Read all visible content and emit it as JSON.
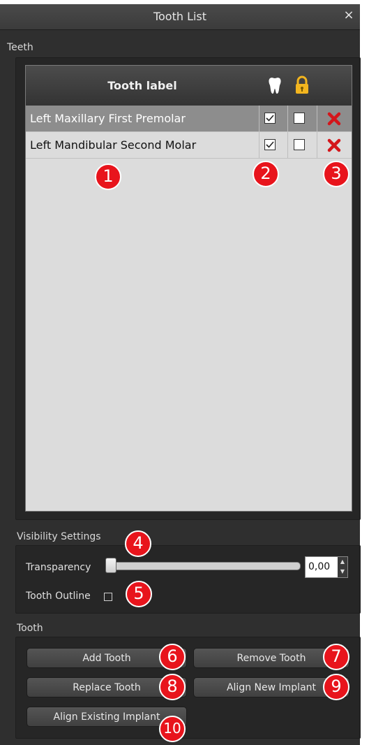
{
  "window": {
    "title": "Tooth List",
    "close_glyph": "×"
  },
  "teeth_section": {
    "label": "Teeth",
    "table": {
      "header_label": "Tooth label",
      "visibility_icon": "tooth-icon",
      "lock_icon": "padlock-icon",
      "rows": [
        {
          "name": "Left Maxillary First Premolar",
          "visible": true,
          "locked": false,
          "selected": true
        },
        {
          "name": "Left Mandibular Second Molar",
          "visible": true,
          "locked": false,
          "selected": false
        }
      ]
    }
  },
  "visibility_section": {
    "label": "Visibility Settings",
    "transparency_label": "Transparency",
    "transparency_value": "0,00",
    "tooth_outline_label": "Tooth Outline",
    "tooth_outline_checked": false
  },
  "tooth_section": {
    "label": "Tooth",
    "buttons": {
      "add": "Add Tooth",
      "remove": "Remove Tooth",
      "replace": "Replace Tooth",
      "align_new": "Align New Implant",
      "align_existing": "Align Existing Implant"
    }
  },
  "callouts": [
    "1",
    "2",
    "3",
    "4",
    "5",
    "6",
    "7",
    "8",
    "9",
    "10"
  ],
  "colors": {
    "callout": "#e8141c",
    "delete_x": "#d4161b",
    "lock": "#f2b51f",
    "selected_row": "#8d8d8d"
  }
}
